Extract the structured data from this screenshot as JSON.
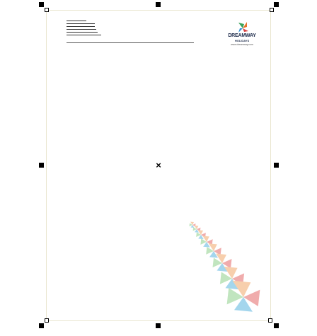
{
  "logo": {
    "brand": "DREAMWAY",
    "subtitle": "HOLIDAYS",
    "url": "www.dreamway.com"
  },
  "colors": {
    "page_border": "#e9e6cf",
    "handle": "#000000",
    "pinwheel_green": "#8fd18b",
    "pinwheel_blue": "#5bb6e0",
    "pinwheel_orange": "#f2a86b",
    "pinwheel_red": "#e56a6a"
  },
  "icons": {
    "center": "center-cross-icon",
    "logo": "pinwheel-logo-icon"
  }
}
